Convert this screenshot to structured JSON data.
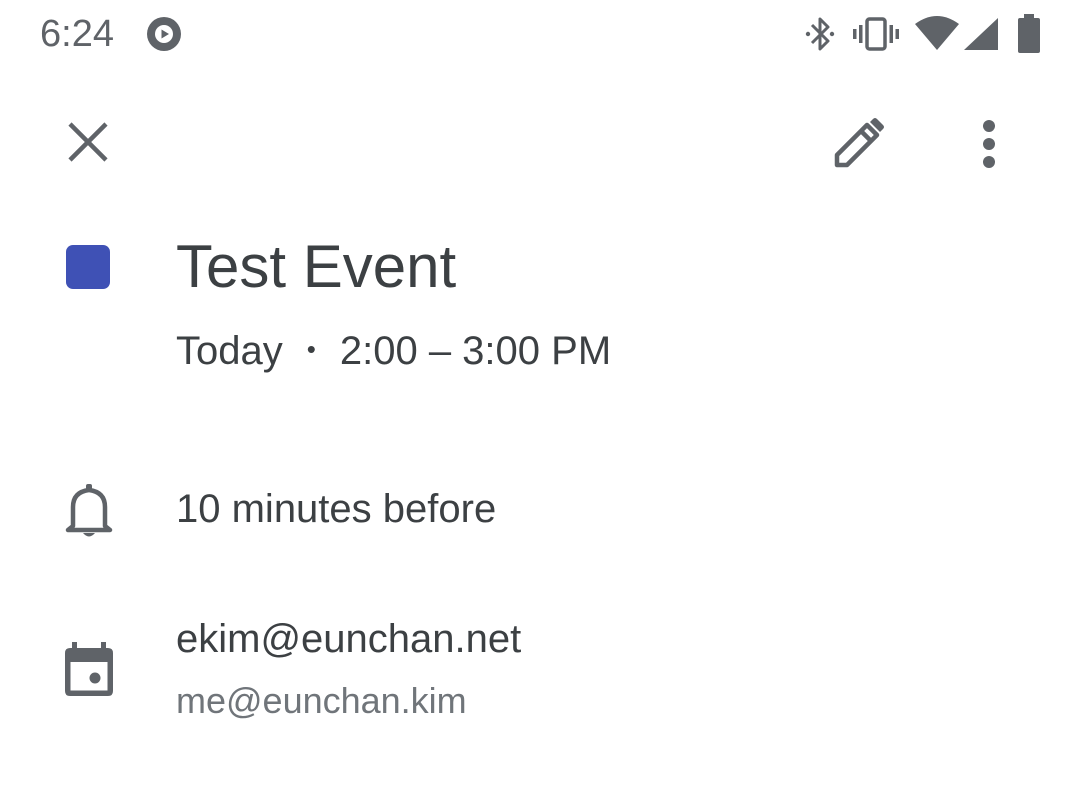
{
  "status_bar": {
    "time": "6:24",
    "icons": [
      "play-circle-icon",
      "bluetooth-icon",
      "vibrate-icon",
      "wifi-icon",
      "cellular-signal-icon",
      "battery-icon"
    ]
  },
  "toolbar": {
    "close_icon": "close-icon",
    "edit_icon": "pencil-icon",
    "more_icon": "more-vert-icon"
  },
  "event": {
    "title": "Test Event",
    "day": "Today",
    "separator": "•",
    "time_range": "2:00 – 3:00 PM",
    "color": "#3f51b5"
  },
  "reminder": {
    "icon": "bell-icon",
    "text": "10 minutes before"
  },
  "calendar": {
    "icon": "calendar-icon",
    "name": "ekim@eunchan.net",
    "owner": "me@eunchan.kim"
  },
  "colors": {
    "primary_text": "#3c4043",
    "secondary_text": "#70757a",
    "icon": "#5f6368",
    "event_color": "#3f51b5"
  }
}
